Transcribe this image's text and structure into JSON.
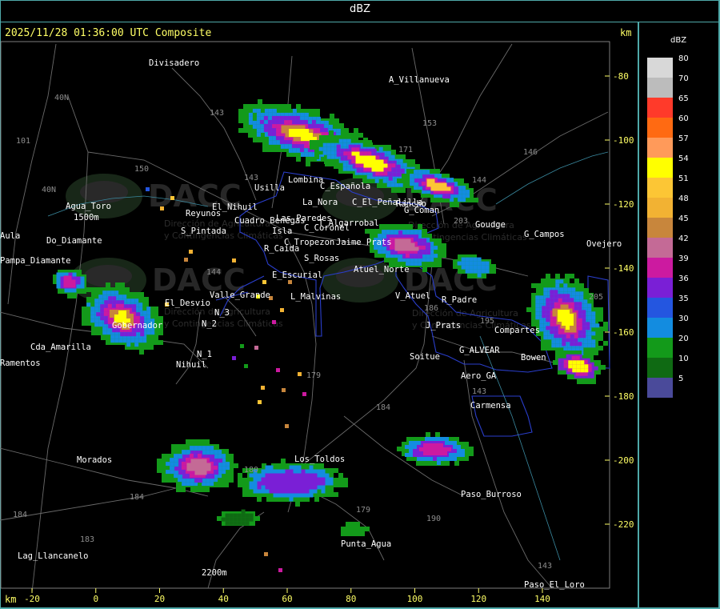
{
  "header": {
    "title": "dBZ",
    "timestamp": "2025/11/28 01:36:00 UTC Composite",
    "unit_top": "km",
    "unit_bottom": "km"
  },
  "axes": {
    "x_ticks": [
      -20,
      0,
      20,
      40,
      60,
      80,
      100,
      120,
      140
    ],
    "y_ticks": [
      -80,
      -100,
      -120,
      -140,
      -160,
      -180,
      -200,
      -220
    ]
  },
  "legend": {
    "title": "dBZ",
    "items": [
      {
        "label": "80",
        "color": "#d8d8d8"
      },
      {
        "label": "70",
        "color": "#bcbcbc"
      },
      {
        "label": "65",
        "color": "#ff3a2a"
      },
      {
        "label": "60",
        "color": "#ff6a12"
      },
      {
        "label": "57",
        "color": "#ff9a5a"
      },
      {
        "label": "54",
        "color": "#ffff00"
      },
      {
        "label": "51",
        "color": "#fcc635"
      },
      {
        "label": "48",
        "color": "#f2b233"
      },
      {
        "label": "45",
        "color": "#c8863c"
      },
      {
        "label": "42",
        "color": "#c46a96"
      },
      {
        "label": "39",
        "color": "#cc1aa0"
      },
      {
        "label": "36",
        "color": "#7a1fd6"
      },
      {
        "label": "35",
        "color": "#2456e0"
      },
      {
        "label": "30",
        "color": "#138ce0"
      },
      {
        "label": "20",
        "color": "#139a1a"
      },
      {
        "label": "10",
        "color": "#0f6a13"
      },
      {
        "label": "5",
        "color": "#4a4a9a"
      }
    ]
  },
  "watermark": {
    "brand": "DACC",
    "line1": "Dirección de Agricultura",
    "line2": "y Contingencias Climáticas"
  },
  "places": [
    {
      "name": "Divisadero"
    },
    {
      "name": "A_Villanueva"
    },
    {
      "name": "Usilla"
    },
    {
      "name": "Lombina"
    },
    {
      "name": "C_Española"
    },
    {
      "name": "La_Nora"
    },
    {
      "name": "C_El_Peñalilla"
    },
    {
      "name": "Rancho"
    },
    {
      "name": "G_Coman"
    },
    {
      "name": "Goudge"
    },
    {
      "name": "G_Campos"
    },
    {
      "name": "Ovejero"
    },
    {
      "name": "Agua_Toro"
    },
    {
      "name": "Reyunos"
    },
    {
      "name": "El_Nihuil"
    },
    {
      "name": "Cuadro Benegas"
    },
    {
      "name": "Las_Paredes"
    },
    {
      "name": "Isla"
    },
    {
      "name": "C_Coronel"
    },
    {
      "name": "T_Algarrobal"
    },
    {
      "name": "C_Tropezon"
    },
    {
      "name": "Jaime Prats"
    },
    {
      "name": "Pampa_Diamante"
    },
    {
      "name": "R_Caida"
    },
    {
      "name": "S_Rosas"
    },
    {
      "name": "Atuel_Norte"
    },
    {
      "name": "E_Escurial"
    },
    {
      "name": "El_Desvio"
    },
    {
      "name": "Valle_Grande"
    },
    {
      "name": "L_Malvinas"
    },
    {
      "name": "V_Atuel"
    },
    {
      "name": "R_Padre"
    },
    {
      "name": "J_Prats"
    },
    {
      "name": "Compartes"
    },
    {
      "name": "Cda_Amarilla"
    },
    {
      "name": "Gobernador"
    },
    {
      "name": "G_ALVEAR"
    },
    {
      "name": "Bowen"
    },
    {
      "name": "Nihuil"
    },
    {
      "name": "Soitue"
    },
    {
      "name": "Aero_GA"
    },
    {
      "name": "Carmensa"
    },
    {
      "name": "Morados"
    },
    {
      "name": "Los_Toldos"
    },
    {
      "name": "Paso_Burroso"
    },
    {
      "name": "Punta_Agua"
    },
    {
      "name": "Lag_Llancanelo"
    },
    {
      "name": "Paso_El_Loro"
    },
    {
      "name": "Aula"
    },
    {
      "name": "Ramentos"
    },
    {
      "name": "S_Pintada"
    },
    {
      "name": "N_1"
    },
    {
      "name": "N_2"
    },
    {
      "name": "N_3"
    },
    {
      "name": "Do_Diamante"
    },
    {
      "name": "1500m"
    },
    {
      "name": "2200m"
    }
  ],
  "roads": [
    {
      "label": "40N"
    },
    {
      "label": "40N"
    },
    {
      "label": "101"
    },
    {
      "label": "150"
    },
    {
      "label": "143"
    },
    {
      "label": "143"
    },
    {
      "label": "153"
    },
    {
      "label": "146"
    },
    {
      "label": "144"
    },
    {
      "label": "144"
    },
    {
      "label": "203"
    },
    {
      "label": "186"
    },
    {
      "label": "179"
    },
    {
      "label": "184"
    },
    {
      "label": "184"
    },
    {
      "label": "183"
    },
    {
      "label": "180"
    },
    {
      "label": "179"
    },
    {
      "label": "143"
    },
    {
      "label": "184"
    },
    {
      "label": "190"
    },
    {
      "label": "143"
    },
    {
      "label": "205"
    },
    {
      "label": "171"
    },
    {
      "label": "195"
    }
  ],
  "cells": [
    {
      "x": 20,
      "y": -127,
      "dbz": 48
    },
    {
      "x": 26,
      "y": -135,
      "dbz": 51
    },
    {
      "x": 55,
      "y": -133,
      "dbz": 48
    },
    {
      "x": 57,
      "y": -145,
      "dbz": 45
    },
    {
      "x": 50,
      "y": -150,
      "dbz": 42
    }
  ]
}
